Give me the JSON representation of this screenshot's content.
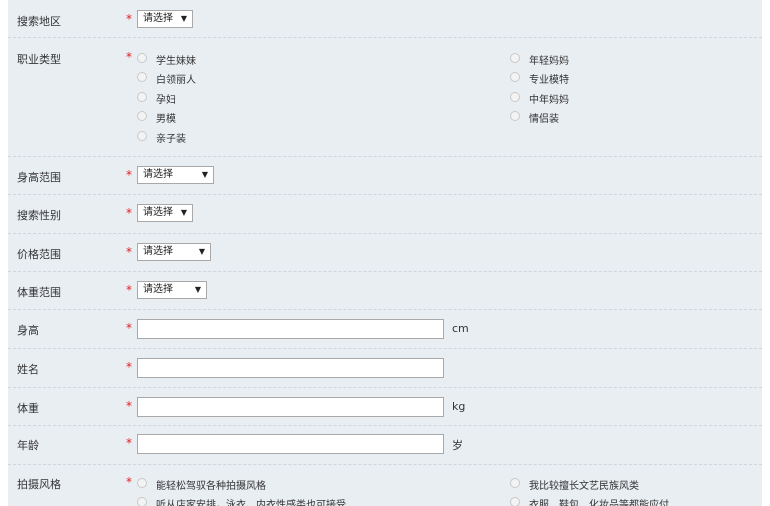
{
  "fields": {
    "region": {
      "label": "搜索地区",
      "value": "请选择"
    },
    "job_type": {
      "label": "职业类型",
      "options_left": [
        "学生妹妹",
        "白领丽人",
        "孕妇",
        "男模",
        "亲子装"
      ],
      "options_right": [
        "年轻妈妈",
        "专业模特",
        "中年妈妈",
        "情侣装"
      ]
    },
    "height_range": {
      "label": "身高范围",
      "value": "请选择"
    },
    "gender": {
      "label": "搜索性别",
      "value": "请选择"
    },
    "price_range": {
      "label": "价格范围",
      "value": "请选择"
    },
    "weight_range": {
      "label": "体重范围",
      "value": "请选择"
    },
    "height": {
      "label": "身高",
      "unit": "cm"
    },
    "name": {
      "label": "姓名"
    },
    "weight": {
      "label": "体重",
      "unit": "kg"
    },
    "age": {
      "label": "年龄",
      "unit": "岁"
    },
    "style": {
      "label": "拍摄风格",
      "options_left": [
        "能轻松驾驭各种拍摄风格",
        "听从店家安排，泳衣、内衣性感类也可接受"
      ],
      "options_right": [
        "我比较擅长文艺民族风类",
        "衣服、鞋包、化妆品等都能应付"
      ]
    }
  },
  "required_mark": "*",
  "dropdown_arrow": "▼"
}
